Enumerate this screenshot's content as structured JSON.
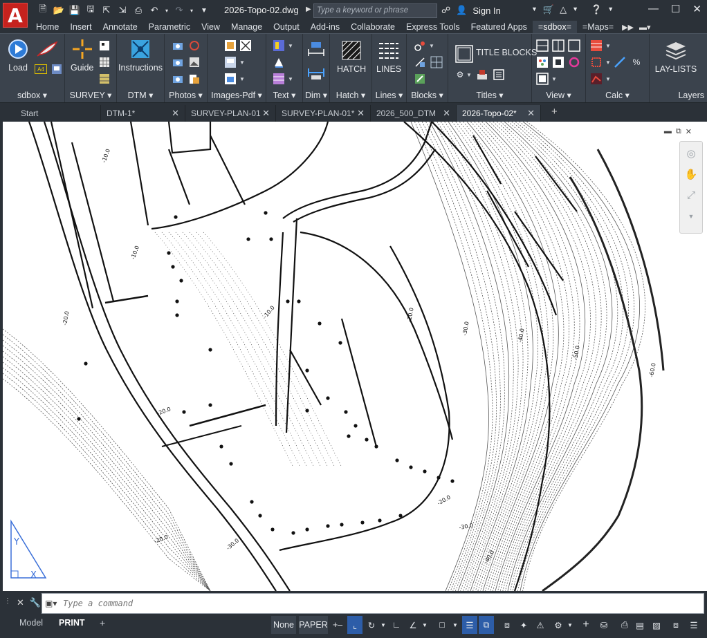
{
  "app": {
    "logo_letter": "A",
    "document_title": "2026-Topo-02.dwg",
    "search_placeholder": "Type a keyword or phrase",
    "sign_in": "Sign In",
    "accent_color": "#c6221e"
  },
  "ribbon_tabs": [
    "Home",
    "Insert",
    "Annotate",
    "Parametric",
    "View",
    "Manage",
    "Output",
    "Add-ins",
    "Collaborate",
    "Express Tools",
    "Featured Apps",
    "=sdbox=",
    "=Maps="
  ],
  "active_ribbon_tab": "=sdbox=",
  "ribbon_groups": {
    "sdbox": {
      "title": "sdbox",
      "load": "Load",
      "a4": "A4"
    },
    "survey": {
      "title": "SURVEY",
      "guide": "Guide"
    },
    "dtm": {
      "title": "DTM",
      "instructions": "Instructions"
    },
    "photos": {
      "title": "Photos"
    },
    "images_pdf": {
      "title": "Images-Pdf"
    },
    "text": {
      "title": "Text"
    },
    "dim": {
      "title": "Dim"
    },
    "hatch": {
      "title": "Hatch",
      "hatch_btn": "HATCH"
    },
    "lines": {
      "title": "Lines",
      "lines_btn": "LINES"
    },
    "blocks": {
      "title": "Blocks"
    },
    "titles": {
      "title": "Titles",
      "title_blocks": "TITLE BLOCKS"
    },
    "view": {
      "title": "View"
    },
    "calc": {
      "title": "Calc"
    },
    "layers": {
      "title": "Layers",
      "lay_lists": "LAY-LISTS"
    }
  },
  "file_tabs": [
    {
      "label": "Start",
      "closable": false
    },
    {
      "label": "DTM-1*",
      "closable": true
    },
    {
      "label": "SURVEY-PLAN-01",
      "closable": true
    },
    {
      "label": "SURVEY-PLAN-01*",
      "closable": true
    },
    {
      "label": "2026_500_DTM",
      "closable": true
    },
    {
      "label": "2026-Topo-02*",
      "closable": true,
      "active": true
    }
  ],
  "drawing": {
    "contour_labels": [
      "-10.0",
      "-10.0",
      "-10.0",
      "-20.0",
      "-20.0",
      "-20.0",
      "-20.0",
      "-20.0",
      "-30.0",
      "-30.0",
      "-30.0",
      "-40.0",
      "-40.0",
      "-50.0",
      "-60.0"
    ],
    "ucs_axis_labels": [
      "Y",
      "X"
    ]
  },
  "command_line": {
    "placeholder": "Type a command"
  },
  "status_bar": {
    "layout_tabs": [
      "Model",
      "PRINT"
    ],
    "active_layout": "PRINT",
    "snap_none": "None",
    "space": "PAPER"
  }
}
